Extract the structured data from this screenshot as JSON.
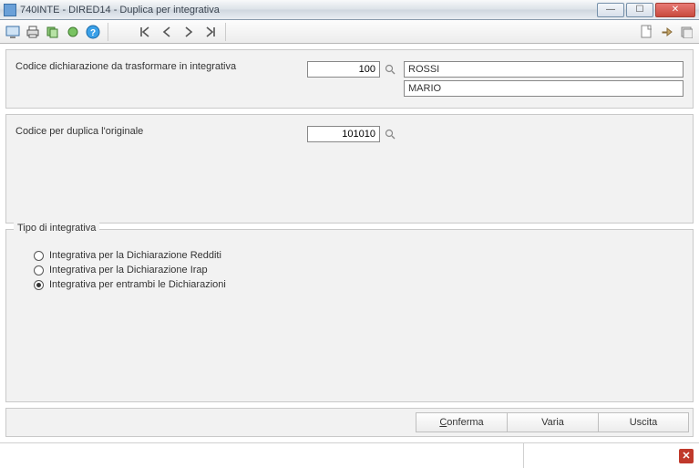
{
  "window": {
    "title": "740INTE  - DIRED14 - Duplica per integrativa"
  },
  "section1": {
    "label": "Codice dichiarazione da trasformare in integrativa",
    "value": "100",
    "surname": "ROSSI",
    "name": "MARIO"
  },
  "section2": {
    "label": "Codice per duplica l'originale",
    "value": "101010"
  },
  "fieldset": {
    "legend": "Tipo di integrativa",
    "options": [
      {
        "label": "Integrativa per la Dichiarazione Redditi",
        "checked": false
      },
      {
        "label": "Integrativa per la Dichiarazione Irap",
        "checked": false
      },
      {
        "label": "Integrativa per entrambi le Dichiarazioni",
        "checked": true
      }
    ]
  },
  "buttons": {
    "confirm": "Conferma",
    "vary": "Varia",
    "exit": "Uscita"
  }
}
